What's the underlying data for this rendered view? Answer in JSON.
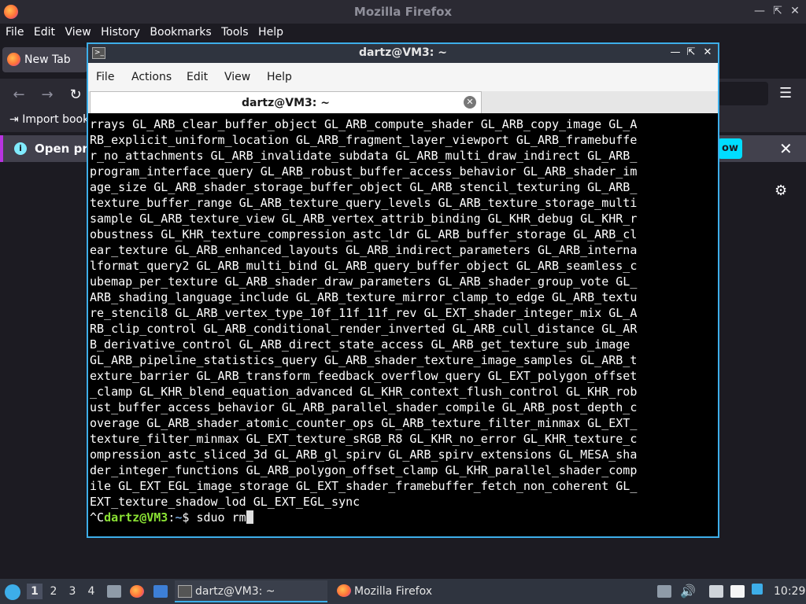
{
  "firefox": {
    "window_title": "Mozilla Firefox",
    "menu": [
      "File",
      "Edit",
      "View",
      "History",
      "Bookmarks",
      "Tools",
      "Help"
    ],
    "tab_label": "New Tab",
    "bookmarks_import": "Import book",
    "notification_text": "Open pre",
    "notification_button": "ow"
  },
  "terminal": {
    "window_title": "dartz@VM3: ~",
    "menu": [
      "File",
      "Actions",
      "Edit",
      "View",
      "Help"
    ],
    "tab_label": "dartz@VM3: ~",
    "output_lines": [
      "rrays GL_ARB_clear_buffer_object GL_ARB_compute_shader GL_ARB_copy_image GL_A",
      "RB_explicit_uniform_location GL_ARB_fragment_layer_viewport GL_ARB_framebuffe",
      "r_no_attachments GL_ARB_invalidate_subdata GL_ARB_multi_draw_indirect GL_ARB_",
      "program_interface_query GL_ARB_robust_buffer_access_behavior GL_ARB_shader_im",
      "age_size GL_ARB_shader_storage_buffer_object GL_ARB_stencil_texturing GL_ARB_",
      "texture_buffer_range GL_ARB_texture_query_levels GL_ARB_texture_storage_multi",
      "sample GL_ARB_texture_view GL_ARB_vertex_attrib_binding GL_KHR_debug GL_KHR_r",
      "obustness GL_KHR_texture_compression_astc_ldr GL_ARB_buffer_storage GL_ARB_cl",
      "ear_texture GL_ARB_enhanced_layouts GL_ARB_indirect_parameters GL_ARB_interna",
      "lformat_query2 GL_ARB_multi_bind GL_ARB_query_buffer_object GL_ARB_seamless_c",
      "ubemap_per_texture GL_ARB_shader_draw_parameters GL_ARB_shader_group_vote GL_",
      "ARB_shading_language_include GL_ARB_texture_mirror_clamp_to_edge GL_ARB_textu",
      "re_stencil8 GL_ARB_vertex_type_10f_11f_11f_rev GL_EXT_shader_integer_mix GL_A",
      "RB_clip_control GL_ARB_conditional_render_inverted GL_ARB_cull_distance GL_AR",
      "B_derivative_control GL_ARB_direct_state_access GL_ARB_get_texture_sub_image",
      "GL_ARB_pipeline_statistics_query GL_ARB_shader_texture_image_samples GL_ARB_t",
      "exture_barrier GL_ARB_transform_feedback_overflow_query GL_EXT_polygon_offset",
      "_clamp GL_KHR_blend_equation_advanced GL_KHR_context_flush_control GL_KHR_rob",
      "ust_buffer_access_behavior GL_ARB_parallel_shader_compile GL_ARB_post_depth_c",
      "overage GL_ARB_shader_atomic_counter_ops GL_ARB_texture_filter_minmax GL_EXT_",
      "texture_filter_minmax GL_EXT_texture_sRGB_R8 GL_KHR_no_error GL_KHR_texture_c",
      "ompression_astc_sliced_3d GL_ARB_gl_spirv GL_ARB_spirv_extensions GL_MESA_sha",
      "der_integer_functions GL_ARB_polygon_offset_clamp GL_KHR_parallel_shader_comp",
      "ile GL_EXT_EGL_image_storage GL_EXT_shader_framebuffer_fetch_non_coherent GL_",
      "EXT_texture_shadow_lod GL_EXT_EGL_sync"
    ],
    "prompt_prefix": "^C",
    "prompt_user": "dartz@VM3",
    "prompt_sep": ":",
    "prompt_path": "~",
    "prompt_symbol": "$ ",
    "command": "sduo rm"
  },
  "taskbar": {
    "workspaces": [
      "1",
      "2",
      "3",
      "4"
    ],
    "windows": [
      {
        "label": "dartz@VM3: ~"
      },
      {
        "label": "Mozilla Firefox"
      }
    ],
    "clock": "10:29"
  }
}
